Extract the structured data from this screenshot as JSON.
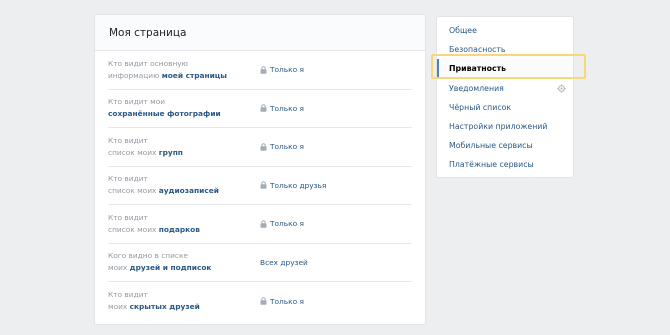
{
  "main": {
    "title": "Моя страница",
    "rows": [
      {
        "line1": "Кто видит основную",
        "line2_prefix": "информацию ",
        "line2_em": "моей страницы",
        "value": "Только я",
        "lock": true
      },
      {
        "line1": "Кто видит мои",
        "line2_prefix": "",
        "line2_em": "сохранённые фотографии",
        "value": "Только я",
        "lock": true
      },
      {
        "line1": "Кто видит",
        "line2_prefix": "список моих ",
        "line2_em": "групп",
        "value": "Только я",
        "lock": true
      },
      {
        "line1": "Кто видит",
        "line2_prefix": "список моих ",
        "line2_em": "аудиозаписей",
        "value": "Только друзья",
        "lock": true
      },
      {
        "line1": "Кто видит",
        "line2_prefix": "список моих ",
        "line2_em": "подарков",
        "value": "Только я",
        "lock": true
      },
      {
        "line1": "Кого видно в списке",
        "line2_prefix": "моих ",
        "line2_em": "друзей и подписок",
        "value": "Всех друзей",
        "lock": false
      },
      {
        "line1": "Кто видит",
        "line2_prefix": "моих ",
        "line2_em": "скрытых друзей",
        "value": "Только я",
        "lock": true
      }
    ]
  },
  "sidebar": {
    "items": [
      {
        "label": "Общее"
      },
      {
        "label": "Безопасность"
      },
      {
        "label": "Приватность",
        "active": true
      },
      {
        "label": "Уведомления",
        "icon": "gear-icon"
      },
      {
        "label": "Чёрный список"
      },
      {
        "label": "Настройки приложений"
      },
      {
        "label": "Мобильные сервисы"
      },
      {
        "label": "Платёжные сервисы"
      }
    ]
  },
  "colors": {
    "link": "#2a5885",
    "muted": "#939aa3",
    "background": "#edeef0",
    "highlight": "#f5d87a",
    "active_marker": "#5181b8"
  }
}
